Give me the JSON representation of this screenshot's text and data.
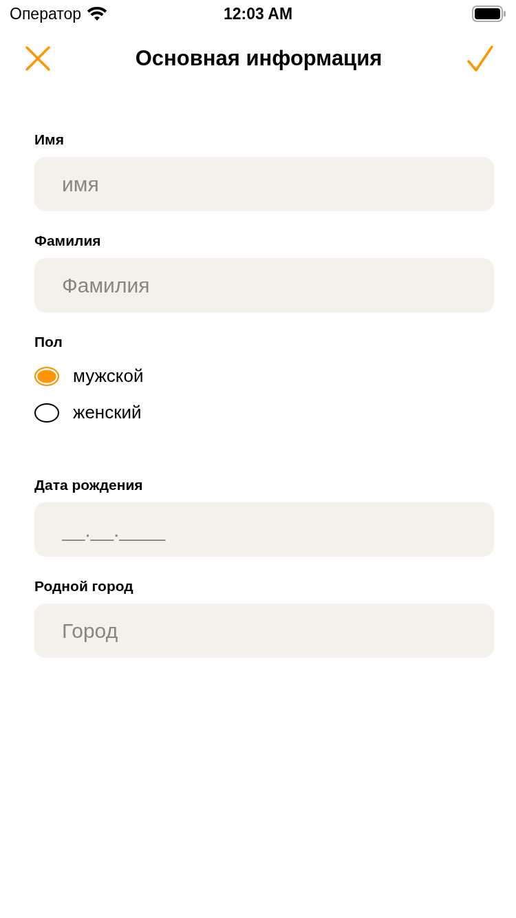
{
  "status_bar": {
    "carrier": "Оператор",
    "time": "12:03 AM"
  },
  "nav": {
    "title": "Основная информация"
  },
  "sections": [
    {
      "kind": "field",
      "label": "Имя",
      "placeholder": "имя"
    },
    {
      "kind": "field",
      "label": "Фамилия",
      "placeholder": "Фамилия"
    },
    {
      "kind": "radio-group",
      "label": "Пол",
      "options": [
        {
          "label": "мужской",
          "selected": true
        },
        {
          "label": "женский",
          "selected": false
        }
      ]
    },
    {
      "kind": "field",
      "label": "Дата рождения",
      "placeholder": "__.__.____"
    },
    {
      "kind": "field",
      "label": "Родной город",
      "placeholder": "Город"
    }
  ]
}
